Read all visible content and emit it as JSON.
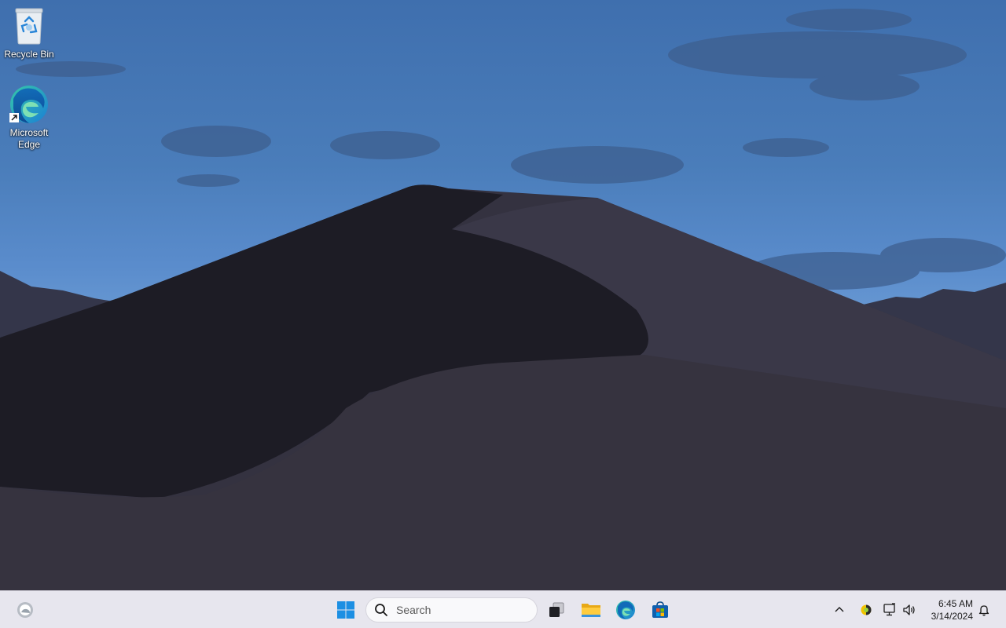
{
  "desktop": {
    "icons": [
      {
        "label": "Recycle Bin",
        "icon": "recycle-bin-icon"
      },
      {
        "label": "Microsoft Edge",
        "icon": "edge-icon"
      }
    ]
  },
  "taskbar": {
    "widgets_icon": "weather-widget-icon",
    "start_icon": "windows-start-icon",
    "search": {
      "text": "Search",
      "icon": "search-icon"
    },
    "pinned": [
      {
        "icon": "task-view-icon"
      },
      {
        "icon": "file-explorer-icon"
      },
      {
        "icon": "edge-icon"
      },
      {
        "icon": "microsoft-store-icon"
      }
    ],
    "tray": {
      "overflow_icon": "chevron-up-icon",
      "icons": [
        "app-tray-icon",
        "network-icon",
        "volume-icon"
      ],
      "time": "6:45 AM",
      "date": "3/14/2024",
      "notification_icon": "bell-icon"
    }
  },
  "colors": {
    "taskbar_bg": "#e7e6ee",
    "sky_top": "#3f6fae",
    "dune_dark": "#2a2833",
    "start_blue": "#1c8fe3"
  }
}
